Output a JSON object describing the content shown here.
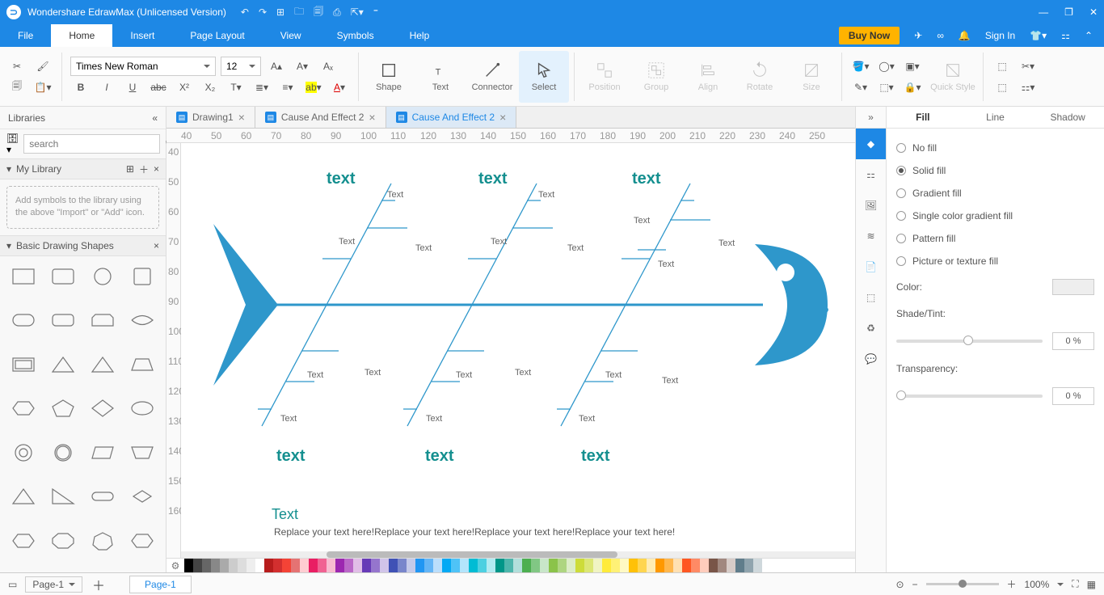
{
  "app": {
    "title": "Wondershare EdrawMax (Unlicensed Version)"
  },
  "menu": {
    "items": [
      "File",
      "Home",
      "Insert",
      "Page Layout",
      "View",
      "Symbols",
      "Help"
    ],
    "active": 1,
    "buynow": "Buy Now",
    "signin": "Sign In"
  },
  "ribbon": {
    "font": "Times New Roman",
    "size": "12",
    "bigbtns": [
      "Shape",
      "Text",
      "Connector",
      "Select",
      "Position",
      "Group",
      "Align",
      "Rotate",
      "Size",
      "Quick Style"
    ]
  },
  "left": {
    "title": "Libraries",
    "search_ph": "search",
    "mylib": "My Library",
    "hint": "Add symbols to the library using the above \"Import\" or \"Add\" icon.",
    "basic": "Basic Drawing Shapes"
  },
  "tabs": [
    {
      "label": "Drawing1",
      "active": false
    },
    {
      "label": "Cause And Effect 2",
      "active": false
    },
    {
      "label": "Cause And Effect 2",
      "active": true
    }
  ],
  "canvas": {
    "causes_top": [
      "text",
      "text",
      "text"
    ],
    "causes_bot": [
      "text",
      "text",
      "text"
    ],
    "note": "Text",
    "title": "Text",
    "desc": "Replace your text here!Replace your text here!Replace your text here!Replace your text here!"
  },
  "right": {
    "tabs": [
      "Fill",
      "Line",
      "Shadow"
    ],
    "active": 0,
    "fill_opts": [
      "No fill",
      "Solid fill",
      "Gradient fill",
      "Single color gradient fill",
      "Pattern fill",
      "Picture or texture fill"
    ],
    "fill_sel": 1,
    "color_lbl": "Color:",
    "shade_lbl": "Shade/Tint:",
    "trans_lbl": "Transparency:",
    "pct": "0 %"
  },
  "status": {
    "page_dd": "Page-1",
    "pagetab": "Page-1",
    "zoom": "100%"
  },
  "ruler_h": [
    "40",
    "50",
    "60",
    "70",
    "80",
    "90",
    "100",
    "110",
    "120",
    "130",
    "140",
    "150",
    "160",
    "170",
    "180",
    "190",
    "200",
    "210",
    "220",
    "230",
    "240",
    "250"
  ],
  "ruler_v": [
    "40",
    "50",
    "60",
    "70",
    "80",
    "90",
    "100",
    "110",
    "120",
    "130",
    "140",
    "150",
    "160"
  ],
  "colors": [
    "#000",
    "#444",
    "#666",
    "#888",
    "#aaa",
    "#ccc",
    "#ddd",
    "#eee",
    "#fff",
    "#b71c1c",
    "#d32f2f",
    "#f44336",
    "#e57373",
    "#ffcdd2",
    "#e91e63",
    "#f06292",
    "#f8bbd0",
    "#9c27b0",
    "#ba68c8",
    "#e1bee7",
    "#673ab7",
    "#9575cd",
    "#d1c4e9",
    "#3f51b5",
    "#7986cb",
    "#c5cae9",
    "#2196f3",
    "#64b5f6",
    "#bbdefb",
    "#03a9f4",
    "#4fc3f7",
    "#b3e5fc",
    "#00bcd4",
    "#4dd0e1",
    "#b2ebf2",
    "#009688",
    "#4db6ac",
    "#b2dfdb",
    "#4caf50",
    "#81c784",
    "#c8e6c9",
    "#8bc34a",
    "#aed581",
    "#dcedc8",
    "#cddc39",
    "#dce775",
    "#f0f4c3",
    "#ffeb3b",
    "#fff176",
    "#fff9c4",
    "#ffc107",
    "#ffd54f",
    "#ffecb3",
    "#ff9800",
    "#ffb74d",
    "#ffe0b2",
    "#ff5722",
    "#ff8a65",
    "#ffccbc",
    "#795548",
    "#a1887f",
    "#d7ccc8",
    "#607d8b",
    "#90a4ae",
    "#cfd8dc"
  ]
}
